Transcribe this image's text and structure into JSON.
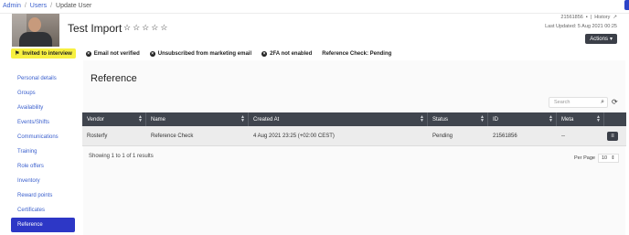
{
  "breadcrumb": {
    "items": [
      "Admin",
      "Users",
      "Update User"
    ],
    "separator": "/"
  },
  "user": {
    "name": "Test Import",
    "stars": [
      "☆",
      "☆",
      "☆",
      "☆",
      "☆"
    ]
  },
  "meta": {
    "id_text": "21561856",
    "history_label": "History",
    "last_updated": "Last Updated: 5 Aug 2021 00:25"
  },
  "actions": {
    "label": "Actions"
  },
  "badges": [
    {
      "label": "Invited to interview",
      "style": "yellow",
      "icon": "flag-icon"
    },
    {
      "label": "Email not verified",
      "icon": "x-circle-icon"
    },
    {
      "label": "Unsubscribed from marketing email",
      "icon": "x-circle-icon"
    },
    {
      "label": "2FA not enabled",
      "icon": "x-circle-icon"
    },
    {
      "label": "Reference Check: Pending",
      "icon": "none"
    }
  ],
  "sidebar": {
    "items": [
      {
        "label": "Personal details"
      },
      {
        "label": "Groups"
      },
      {
        "label": "Availability"
      },
      {
        "label": "Events/Shifts"
      },
      {
        "label": "Communications"
      },
      {
        "label": "Training"
      },
      {
        "label": "Role offers"
      },
      {
        "label": "Inventory"
      },
      {
        "label": "Reward points"
      },
      {
        "label": "Certificates"
      },
      {
        "label": "Reference",
        "active": true
      }
    ]
  },
  "main": {
    "title": "Reference",
    "search": {
      "placeholder": "Search"
    },
    "table": {
      "columns": [
        "Vendor",
        "Name",
        "Created At",
        "Status",
        "ID",
        "Meta"
      ],
      "rows": [
        [
          "Rosterfy",
          "Reference Check",
          "4 Aug 2021 23:25 (+02:00 CEST)",
          "Pending",
          "21561856",
          "--"
        ]
      ]
    },
    "results_text": "Showing 1 to 1 of 1 results",
    "per_page": {
      "label": "Per Page",
      "value": "10"
    }
  },
  "colors": {
    "accent": "#2d37c6",
    "header_dark": "#40454e",
    "badge_yellow": "#f7f040",
    "link": "#3a5fcd"
  }
}
